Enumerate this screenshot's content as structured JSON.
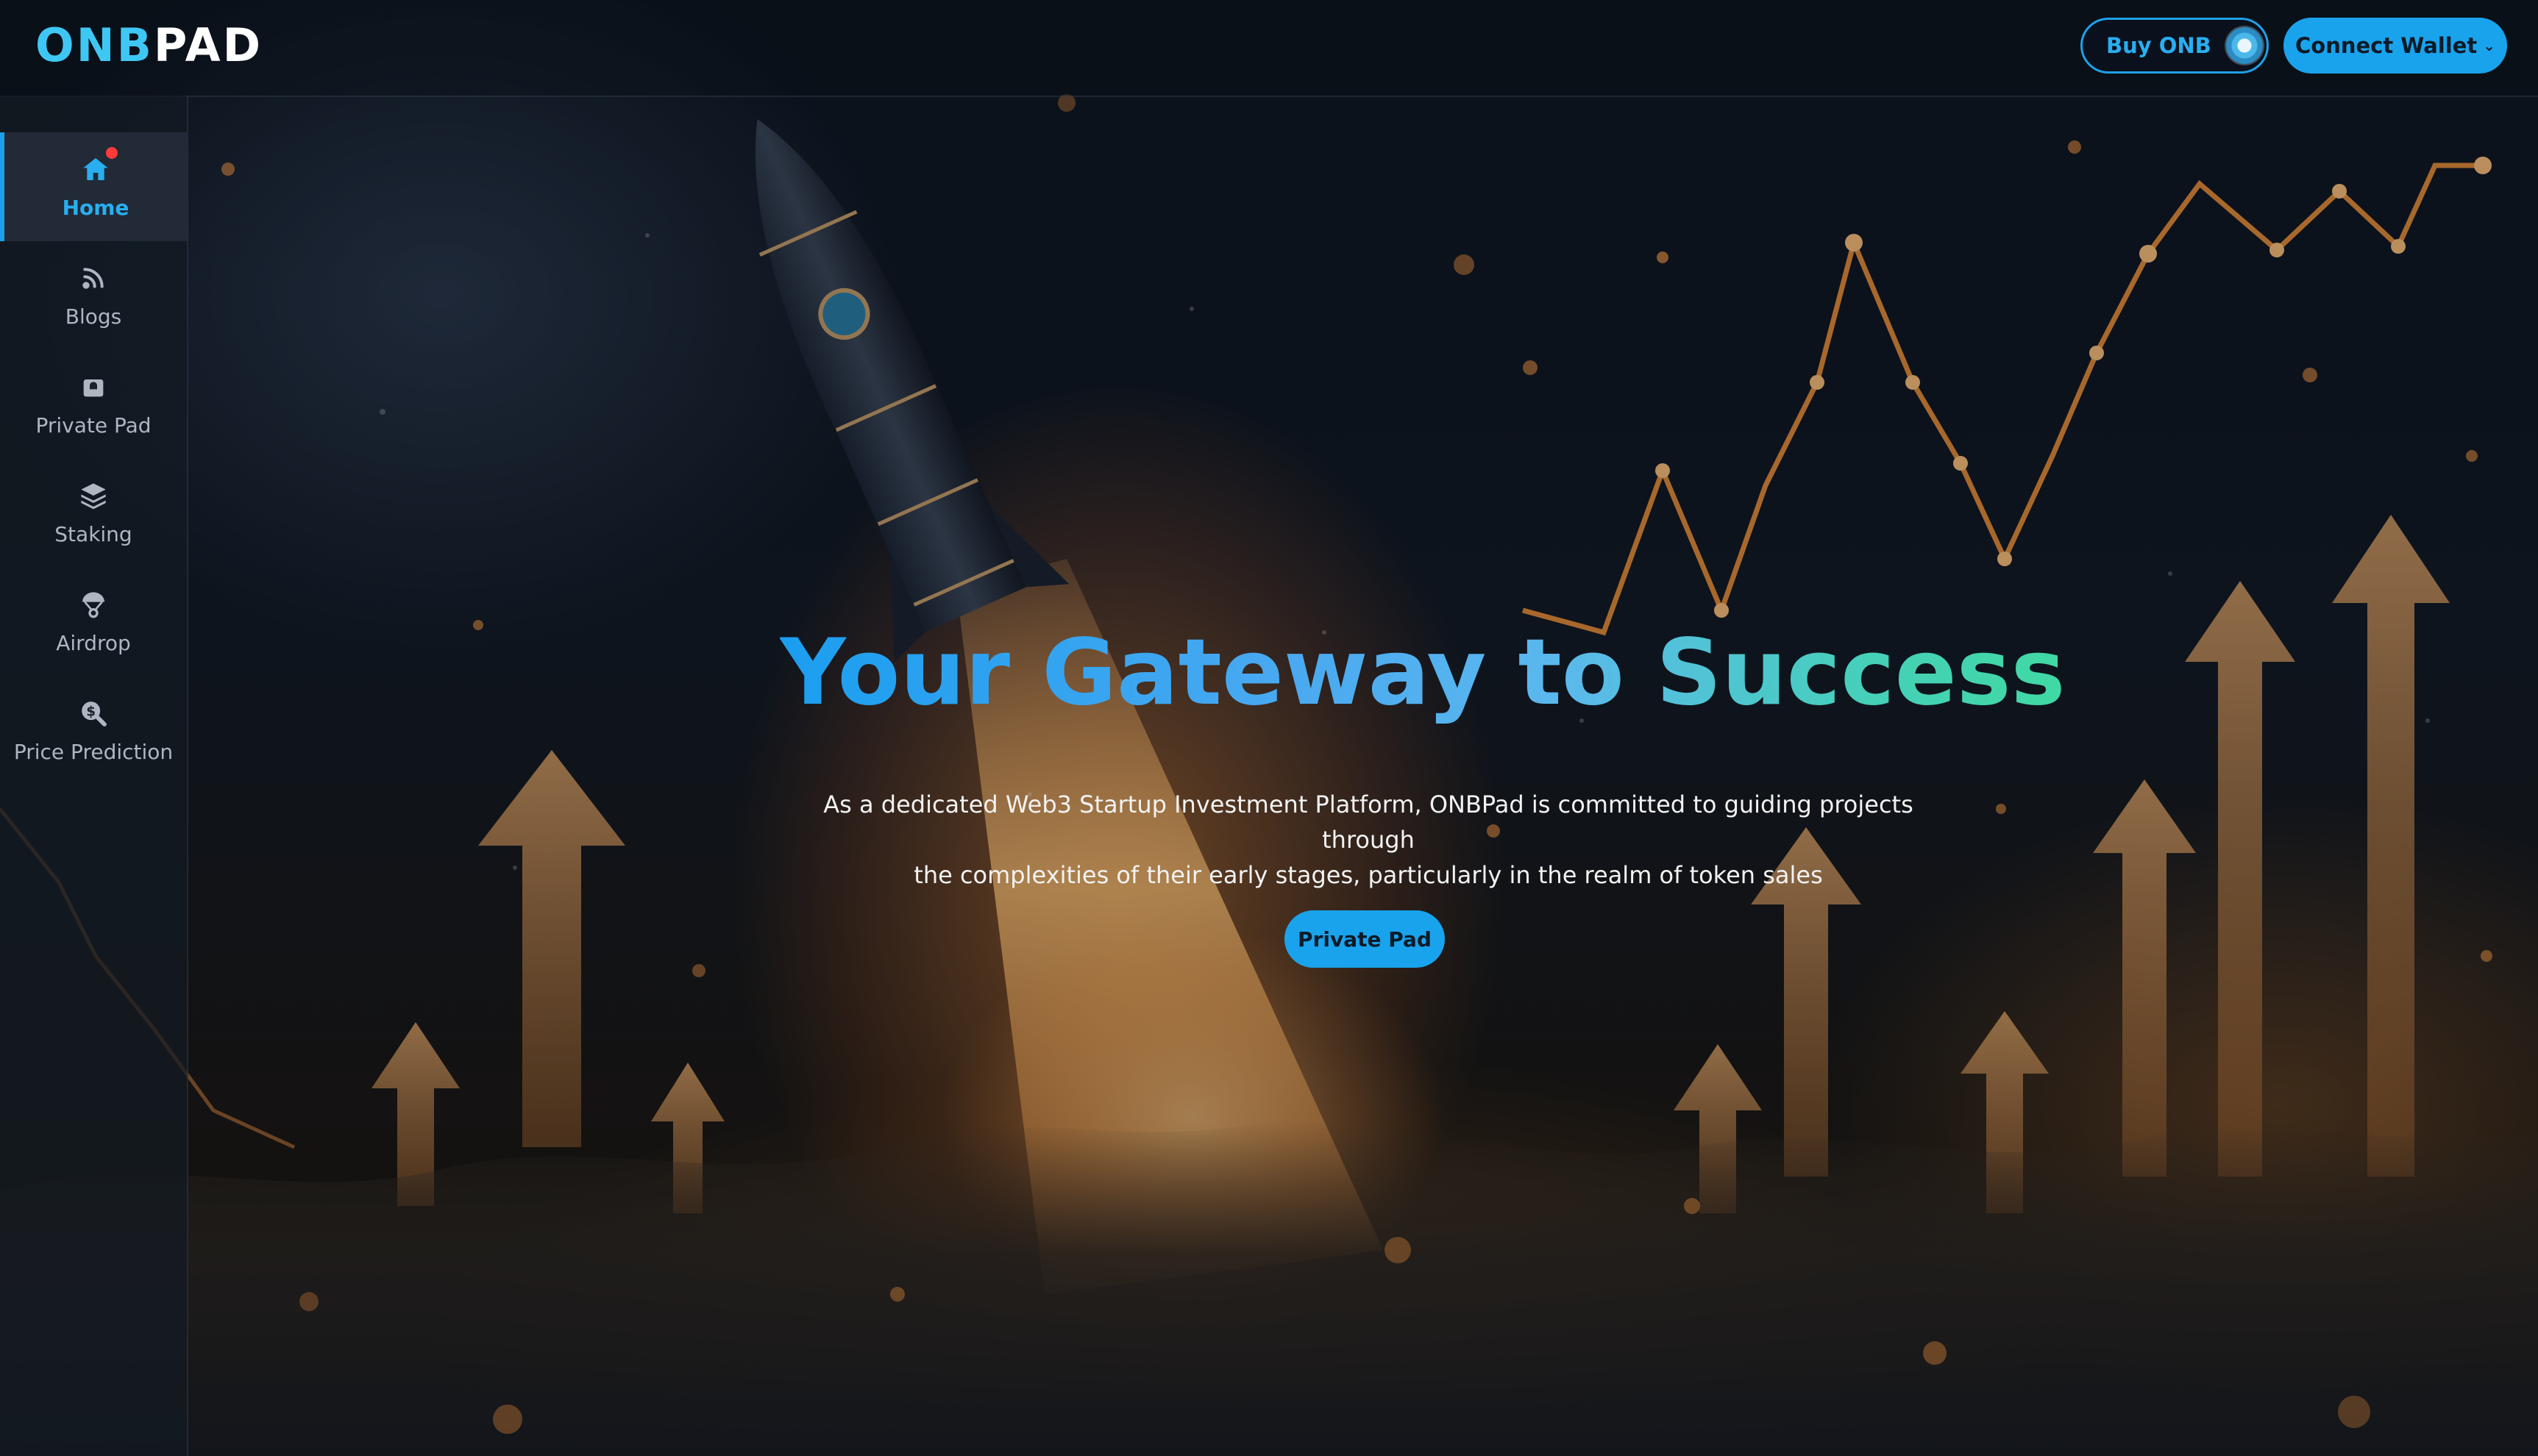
{
  "header": {
    "logo_prefix": "ONB",
    "logo_suffix": "PAD",
    "buy_label": "Buy ONB",
    "connect_label": "Connect Wallet"
  },
  "sidebar": {
    "items": [
      {
        "label": "Home",
        "icon": "home-icon",
        "active": true
      },
      {
        "label": "Blogs",
        "icon": "rss-icon"
      },
      {
        "label": "Private Pad",
        "icon": "lock-icon"
      },
      {
        "label": "Staking",
        "icon": "layers-icon"
      },
      {
        "label": "Airdrop",
        "icon": "parachute-icon"
      },
      {
        "label": "Price Prediction",
        "icon": "search-dollar-icon"
      }
    ]
  },
  "hero": {
    "title": "Your Gateway to Success",
    "description_line1": "As a dedicated Web3 Startup Investment Platform, ONBPad is committed to guiding projects through",
    "description_line2": "the complexities of their early stages, particularly in the realm of token sales",
    "cta_label": "Private Pad"
  },
  "colors": {
    "accent": "#19a3ec",
    "gradient_start": "#1b9ef0",
    "gradient_end": "#40d9a3",
    "notification": "#ff3b3b"
  }
}
